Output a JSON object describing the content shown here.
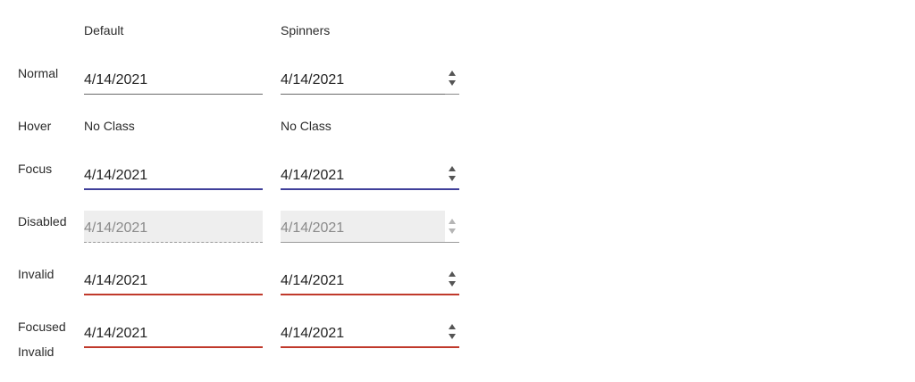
{
  "columns": {
    "default": "Default",
    "spinners": "Spinners"
  },
  "rows": {
    "normal": "Normal",
    "hover": "Hover",
    "focus": "Focus",
    "disabled": "Disabled",
    "invalid": "Invalid",
    "focused_invalid_line1": "Focused",
    "focused_invalid_line2": "Invalid"
  },
  "values": {
    "normal_default": "4/14/2021",
    "normal_spinners": "4/14/2021",
    "hover_default": "No Class",
    "hover_spinners": "No Class",
    "focus_default": "4/14/2021",
    "focus_spinners": "4/14/2021",
    "disabled_default": "4/14/2021",
    "disabled_spinners": "4/14/2021",
    "invalid_default": "4/14/2021",
    "invalid_spinners": "4/14/2021",
    "focused_invalid_default": "4/14/2021",
    "focused_invalid_spinners": "4/14/2021"
  },
  "colors": {
    "focus": "#3f3f9a",
    "invalid": "#c0392b",
    "disabled_bg": "#eeeeee"
  },
  "icons": {
    "spinner_up": "triangle-up-icon",
    "spinner_down": "triangle-down-icon"
  }
}
